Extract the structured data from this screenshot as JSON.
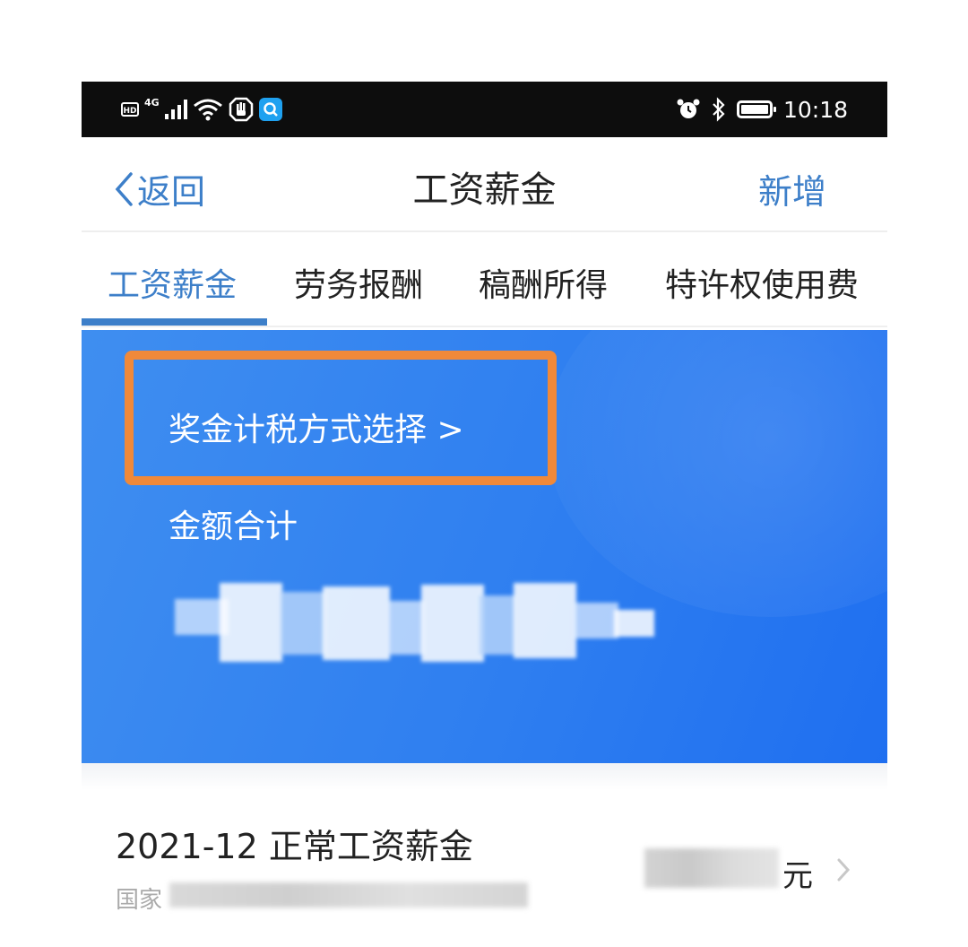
{
  "status_bar": {
    "hd": "HD",
    "network": "4G",
    "time": "10:18",
    "icons": [
      "hd-icon",
      "signal-icon",
      "wifi-icon",
      "hand-icon",
      "app-search-icon",
      "alarm-icon",
      "bluetooth-icon",
      "battery-icon"
    ]
  },
  "nav": {
    "back_label": "返回",
    "title": "工资薪金",
    "add_label": "新增"
  },
  "tabs": [
    {
      "label": "工资薪金",
      "active": true
    },
    {
      "label": "劳务报酬",
      "active": false
    },
    {
      "label": "稿酬所得",
      "active": false
    },
    {
      "label": "特许权使用费",
      "active": false
    }
  ],
  "card": {
    "bonus_link": "奖金计税方式选择 >",
    "total_label": "金额合计"
  },
  "record": {
    "title": "2021-12 正常工资薪金",
    "subtitle_prefix": "国家",
    "unit": "元"
  },
  "colors": {
    "accent": "#3d7fc9",
    "card_blue": "#2f7ff0",
    "highlight": "#f0893a"
  }
}
